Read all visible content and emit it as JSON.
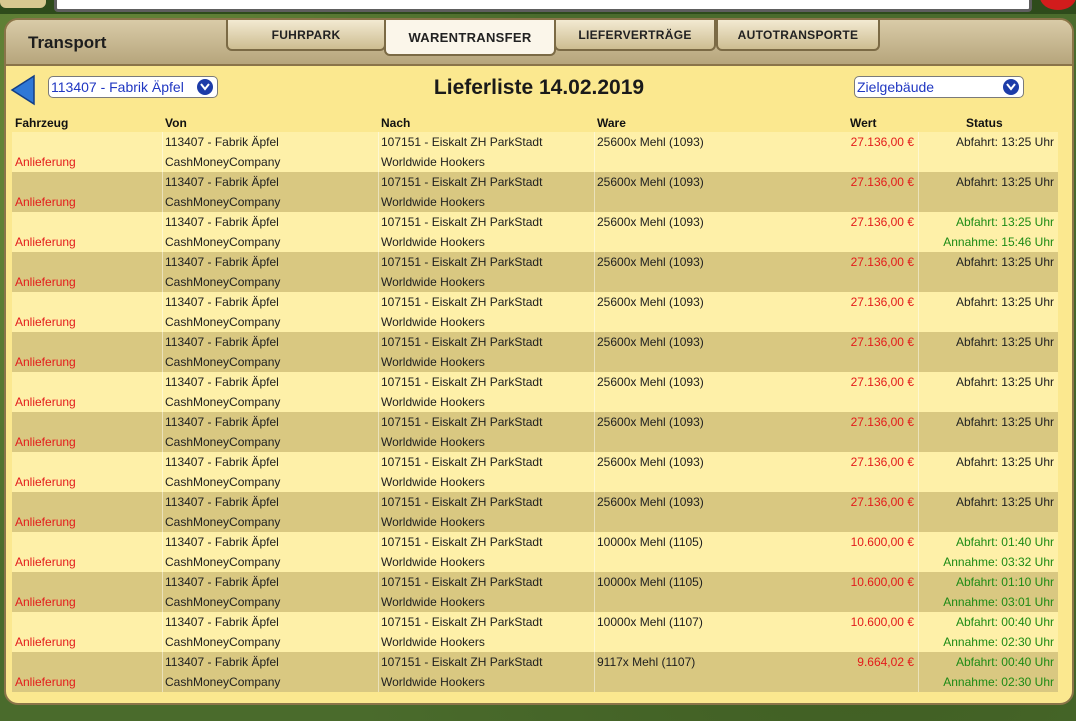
{
  "header": {
    "title": "Transport",
    "tabs": [
      {
        "label": "FUHRPARK",
        "active": false
      },
      {
        "label": "WARENTRANSFER",
        "active": true
      },
      {
        "label": "LIEFERVERTRÄGE",
        "active": false
      },
      {
        "label": "AUTOTRANSPORTE",
        "active": false
      }
    ]
  },
  "toolbar": {
    "source_select": "113407 - Fabrik Äpfel",
    "page_title": "Lieferliste 14.02.2019",
    "target_select": "Zielgebäude"
  },
  "columns": {
    "fahrzeug": "Fahrzeug",
    "von": "Von",
    "nach": "Nach",
    "ware": "Ware",
    "wert": "Wert",
    "status": "Status"
  },
  "rows": [
    {
      "fahrzeug": "Anlieferung",
      "von1": "113407 - Fabrik Äpfel",
      "von2": "CashMoneyCompany",
      "nach1": "107151 - Eiskalt ZH ParkStadt",
      "nach2": "Worldwide Hookers",
      "ware": "25600x Mehl (1093)",
      "wert": "27.136,00 €",
      "status1": "Abfahrt: 13:25 Uhr",
      "status2": "",
      "state": "pending"
    },
    {
      "fahrzeug": "Anlieferung",
      "von1": "113407 - Fabrik Äpfel",
      "von2": "CashMoneyCompany",
      "nach1": "107151 - Eiskalt ZH ParkStadt",
      "nach2": "Worldwide Hookers",
      "ware": "25600x Mehl (1093)",
      "wert": "27.136,00 €",
      "status1": "Abfahrt: 13:25 Uhr",
      "status2": "",
      "state": "pending"
    },
    {
      "fahrzeug": "Anlieferung",
      "von1": "113407 - Fabrik Äpfel",
      "von2": "CashMoneyCompany",
      "nach1": "107151 - Eiskalt ZH ParkStadt",
      "nach2": "Worldwide Hookers",
      "ware": "25600x Mehl (1093)",
      "wert": "27.136,00 €",
      "status1": "Abfahrt: 13:25 Uhr",
      "status2": "Annahme: 15:46 Uhr",
      "state": "accepted"
    },
    {
      "fahrzeug": "Anlieferung",
      "von1": "113407 - Fabrik Äpfel",
      "von2": "CashMoneyCompany",
      "nach1": "107151 - Eiskalt ZH ParkStadt",
      "nach2": "Worldwide Hookers",
      "ware": "25600x Mehl (1093)",
      "wert": "27.136,00 €",
      "status1": "Abfahrt: 13:25 Uhr",
      "status2": "",
      "state": "pending"
    },
    {
      "fahrzeug": "Anlieferung",
      "von1": "113407 - Fabrik Äpfel",
      "von2": "CashMoneyCompany",
      "nach1": "107151 - Eiskalt ZH ParkStadt",
      "nach2": "Worldwide Hookers",
      "ware": "25600x Mehl (1093)",
      "wert": "27.136,00 €",
      "status1": "Abfahrt: 13:25 Uhr",
      "status2": "",
      "state": "pending"
    },
    {
      "fahrzeug": "Anlieferung",
      "von1": "113407 - Fabrik Äpfel",
      "von2": "CashMoneyCompany",
      "nach1": "107151 - Eiskalt ZH ParkStadt",
      "nach2": "Worldwide Hookers",
      "ware": "25600x Mehl (1093)",
      "wert": "27.136,00 €",
      "status1": "Abfahrt: 13:25 Uhr",
      "status2": "",
      "state": "pending"
    },
    {
      "fahrzeug": "Anlieferung",
      "von1": "113407 - Fabrik Äpfel",
      "von2": "CashMoneyCompany",
      "nach1": "107151 - Eiskalt ZH ParkStadt",
      "nach2": "Worldwide Hookers",
      "ware": "25600x Mehl (1093)",
      "wert": "27.136,00 €",
      "status1": "Abfahrt: 13:25 Uhr",
      "status2": "",
      "state": "pending"
    },
    {
      "fahrzeug": "Anlieferung",
      "von1": "113407 - Fabrik Äpfel",
      "von2": "CashMoneyCompany",
      "nach1": "107151 - Eiskalt ZH ParkStadt",
      "nach2": "Worldwide Hookers",
      "ware": "25600x Mehl (1093)",
      "wert": "27.136,00 €",
      "status1": "Abfahrt: 13:25 Uhr",
      "status2": "",
      "state": "pending"
    },
    {
      "fahrzeug": "Anlieferung",
      "von1": "113407 - Fabrik Äpfel",
      "von2": "CashMoneyCompany",
      "nach1": "107151 - Eiskalt ZH ParkStadt",
      "nach2": "Worldwide Hookers",
      "ware": "25600x Mehl (1093)",
      "wert": "27.136,00 €",
      "status1": "Abfahrt: 13:25 Uhr",
      "status2": "",
      "state": "pending"
    },
    {
      "fahrzeug": "Anlieferung",
      "von1": "113407 - Fabrik Äpfel",
      "von2": "CashMoneyCompany",
      "nach1": "107151 - Eiskalt ZH ParkStadt",
      "nach2": "Worldwide Hookers",
      "ware": "25600x Mehl (1093)",
      "wert": "27.136,00 €",
      "status1": "Abfahrt: 13:25 Uhr",
      "status2": "",
      "state": "pending"
    },
    {
      "fahrzeug": "Anlieferung",
      "von1": "113407 - Fabrik Äpfel",
      "von2": "CashMoneyCompany",
      "nach1": "107151 - Eiskalt ZH ParkStadt",
      "nach2": "Worldwide Hookers",
      "ware": "10000x Mehl (1105)",
      "wert": "10.600,00 €",
      "status1": "Abfahrt: 01:40 Uhr",
      "status2": "Annahme: 03:32 Uhr",
      "state": "accepted"
    },
    {
      "fahrzeug": "Anlieferung",
      "von1": "113407 - Fabrik Äpfel",
      "von2": "CashMoneyCompany",
      "nach1": "107151 - Eiskalt ZH ParkStadt",
      "nach2": "Worldwide Hookers",
      "ware": "10000x Mehl (1105)",
      "wert": "10.600,00 €",
      "status1": "Abfahrt: 01:10 Uhr",
      "status2": "Annahme: 03:01 Uhr",
      "state": "accepted"
    },
    {
      "fahrzeug": "Anlieferung",
      "von1": "113407 - Fabrik Äpfel",
      "von2": "CashMoneyCompany",
      "nach1": "107151 - Eiskalt ZH ParkStadt",
      "nach2": "Worldwide Hookers",
      "ware": "10000x Mehl (1107)",
      "wert": "10.600,00 €",
      "status1": "Abfahrt: 00:40 Uhr",
      "status2": "Annahme: 02:30 Uhr",
      "state": "accepted"
    },
    {
      "fahrzeug": "Anlieferung",
      "von1": "113407 - Fabrik Äpfel",
      "von2": "CashMoneyCompany",
      "nach1": "107151 - Eiskalt ZH ParkStadt",
      "nach2": "Worldwide Hookers",
      "ware": "9117x Mehl (1107)",
      "wert": "9.664,02 €",
      "status1": "Abfahrt: 00:40 Uhr",
      "status2": "Annahme: 02:30 Uhr",
      "state": "accepted"
    }
  ],
  "colors": {
    "accent_red": "#e31b1b",
    "accent_green": "#1c8a15",
    "panel_bg": "#fbe88f",
    "link_blue": "#2037c2"
  },
  "icons": {
    "back": "back-arrow-icon",
    "dropdown": "chevron-down-icon"
  }
}
